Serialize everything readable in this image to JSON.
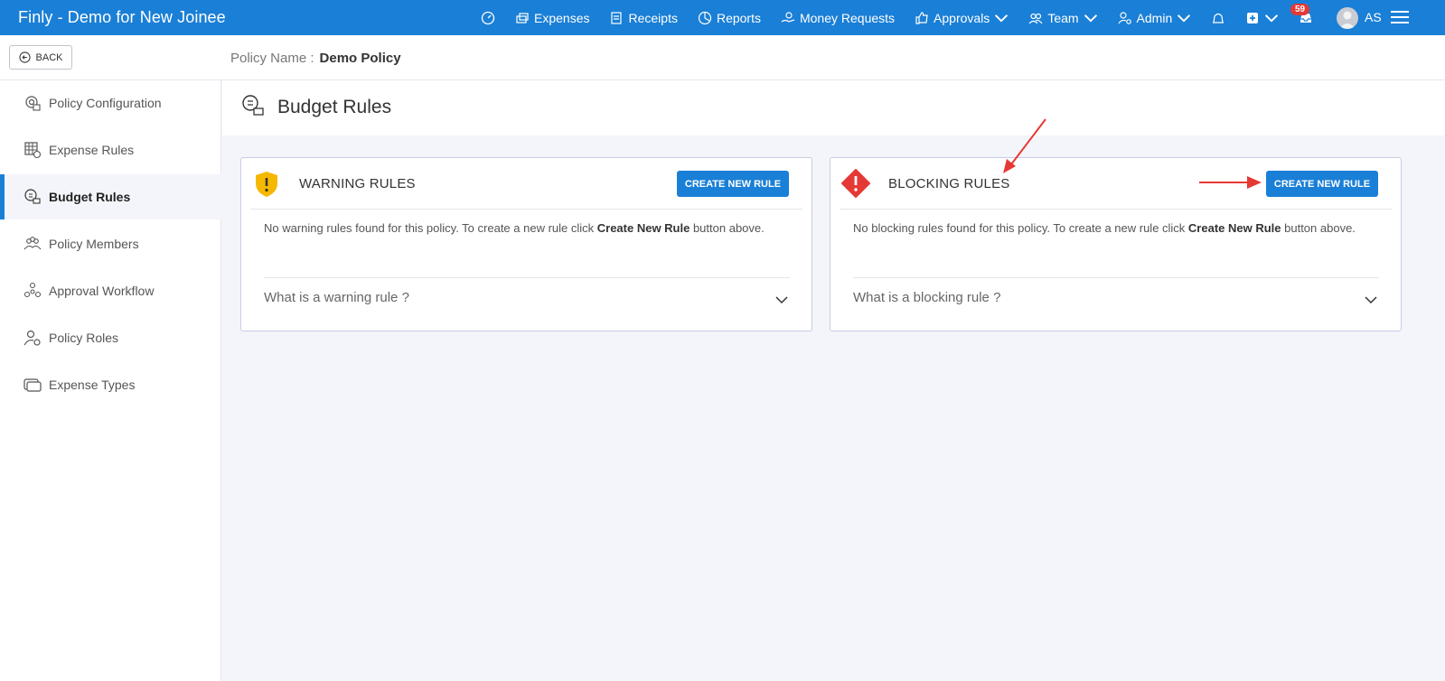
{
  "app": {
    "title": "Finly - Demo for New Joinee"
  },
  "nav": {
    "items": [
      {
        "label": "",
        "icon": "dashboard-icon"
      },
      {
        "label": "Expenses",
        "icon": "expenses-icon"
      },
      {
        "label": "Receipts",
        "icon": "receipts-icon"
      },
      {
        "label": "Reports",
        "icon": "reports-icon"
      },
      {
        "label": "Money Requests",
        "icon": "money-requests-icon"
      },
      {
        "label": "Approvals",
        "icon": "approvals-icon",
        "dropdown": true
      },
      {
        "label": "Team",
        "icon": "team-icon",
        "dropdown": true
      },
      {
        "label": "Admin",
        "icon": "admin-icon",
        "dropdown": true
      }
    ],
    "inbox_count": "59",
    "user_initials": "AS"
  },
  "subbar": {
    "back_label": "BACK",
    "policy_name_label": "Policy Name :",
    "policy_name_value": "Demo Policy"
  },
  "sidebar": {
    "items": [
      {
        "label": "Policy Configuration",
        "icon": "policy-configuration-icon"
      },
      {
        "label": "Expense Rules",
        "icon": "expense-rules-icon"
      },
      {
        "label": "Budget Rules",
        "icon": "budget-rules-icon",
        "active": true
      },
      {
        "label": "Policy Members",
        "icon": "policy-members-icon"
      },
      {
        "label": "Approval Workflow",
        "icon": "approval-workflow-icon"
      },
      {
        "label": "Policy Roles",
        "icon": "policy-roles-icon"
      },
      {
        "label": "Expense Types",
        "icon": "expense-types-icon"
      }
    ]
  },
  "page": {
    "title": "Budget Rules"
  },
  "warning": {
    "title": "WARNING RULES",
    "button": "CREATE NEW RULE",
    "msg_before": "No warning rules found for this policy. To create a new rule click ",
    "msg_bold": "Create New Rule",
    "msg_after": " button above.",
    "faq": "What is a warning rule ?",
    "color": "#f5b800"
  },
  "blocking": {
    "title": "BLOCKING RULES",
    "button": "CREATE NEW RULE",
    "msg_before": "No blocking rules found for this policy. To create a new rule click ",
    "msg_bold": "Create New Rule",
    "msg_after": " button above.",
    "faq": "What is a blocking rule ?",
    "color": "#e53935"
  },
  "colors": {
    "brand": "#1a7fd6",
    "annotation_arrow": "#e53935"
  }
}
